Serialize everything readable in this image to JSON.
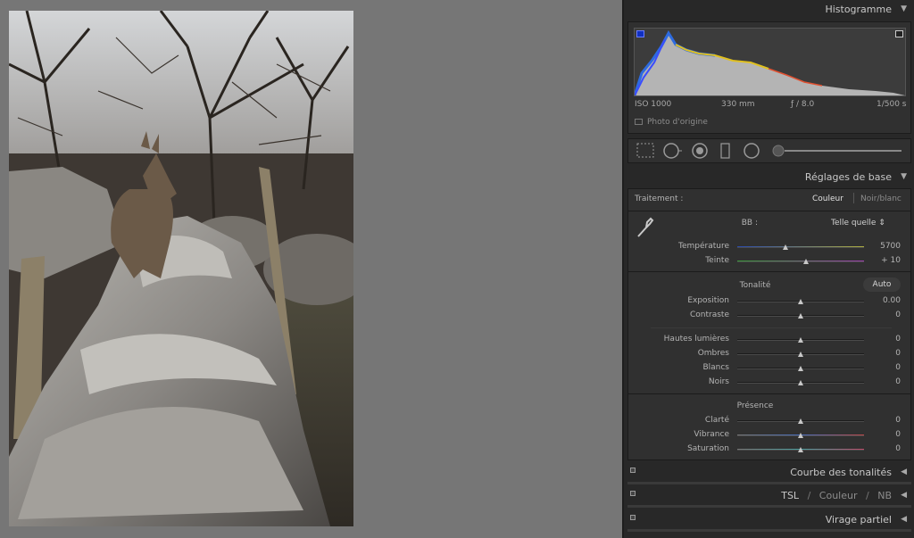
{
  "histogram": {
    "title": "Histogramme",
    "iso": "ISO 1000",
    "focal": "330 mm",
    "aperture": "ƒ / 8.0",
    "shutter": "1/500 s",
    "original_label": "Photo d'origine"
  },
  "basic": {
    "title": "Réglages de base",
    "treatment_label": "Traitement :",
    "treatment_color": "Couleur",
    "treatment_bw": "Noir/blanc",
    "wb_label": "BB :",
    "wb_value": "Telle quelle ⇕",
    "temp_label": "Température",
    "temp_value": "5700",
    "tint_label": "Teinte",
    "tint_value": "+ 10",
    "tone_label": "Tonalité",
    "auto_label": "Auto",
    "exposure_label": "Exposition",
    "exposure_value": "0.00",
    "contrast_label": "Contraste",
    "contrast_value": "0",
    "highlights_label": "Hautes lumières",
    "highlights_value": "0",
    "shadows_label": "Ombres",
    "shadows_value": "0",
    "whites_label": "Blancs",
    "whites_value": "0",
    "blacks_label": "Noirs",
    "blacks_value": "0",
    "presence_label": "Présence",
    "clarity_label": "Clarté",
    "clarity_value": "0",
    "vibrance_label": "Vibrance",
    "vibrance_value": "0",
    "saturation_label": "Saturation",
    "saturation_value": "0"
  },
  "collapsed": {
    "tone_curve": "Courbe des tonalités",
    "hsl": "TSL",
    "sep1": "/",
    "color": "Couleur",
    "sep2": "/",
    "bw": "NB",
    "split": "Virage partiel"
  },
  "sliders": {
    "temperature": 0.38,
    "tint": 0.54,
    "exposure": 0.5,
    "contrast": 0.5,
    "highlights": 0.5,
    "shadows": 0.5,
    "whites": 0.5,
    "blacks": 0.5,
    "clarity": 0.5,
    "vibrance": 0.5,
    "saturation": 0.5
  },
  "colors": {
    "panel_bg": "#282828",
    "section_bg": "#303030",
    "text": "#b4b4b4"
  }
}
